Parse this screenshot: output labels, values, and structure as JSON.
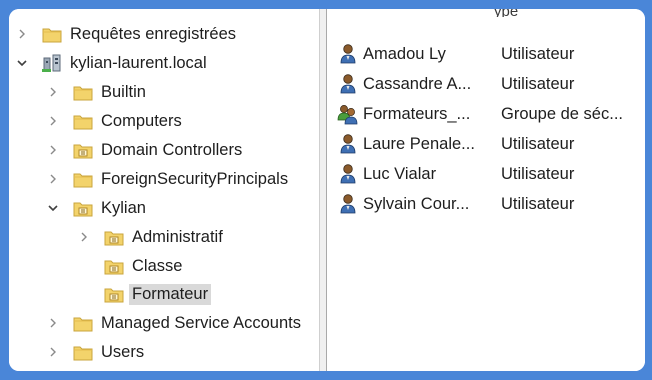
{
  "tree": {
    "items": [
      {
        "label": "Requêtes enregistrées",
        "icon": "folder-icon",
        "expander": "collapsed",
        "depth": 0
      },
      {
        "label": "kylian-laurent.local",
        "icon": "domain-icon",
        "expander": "expanded",
        "depth": 0
      },
      {
        "label": "Builtin",
        "icon": "folder-icon",
        "expander": "collapsed",
        "depth": 1
      },
      {
        "label": "Computers",
        "icon": "folder-icon",
        "expander": "collapsed",
        "depth": 1
      },
      {
        "label": "Domain Controllers",
        "icon": "ou-icon",
        "expander": "collapsed",
        "depth": 1
      },
      {
        "label": "ForeignSecurityPrincipals",
        "icon": "folder-icon",
        "expander": "collapsed",
        "depth": 1
      },
      {
        "label": "Kylian",
        "icon": "ou-icon",
        "expander": "expanded",
        "depth": 1
      },
      {
        "label": "Administratif",
        "icon": "ou-icon",
        "expander": "collapsed",
        "depth": 2
      },
      {
        "label": "Classe",
        "icon": "ou-icon",
        "expander": "none",
        "depth": 2
      },
      {
        "label": "Formateur",
        "icon": "ou-icon",
        "expander": "none",
        "depth": 2,
        "selected": true
      },
      {
        "label": "Managed Service Accounts",
        "icon": "folder-icon",
        "expander": "collapsed",
        "depth": 1
      },
      {
        "label": "Users",
        "icon": "folder-icon",
        "expander": "collapsed",
        "depth": 1
      }
    ]
  },
  "list": {
    "header_type_partial": "ype",
    "rows": [
      {
        "name": "Amadou Ly",
        "type": "Utilisateur",
        "icon": "user-icon"
      },
      {
        "name": "Cassandre A...",
        "type": "Utilisateur",
        "icon": "user-icon"
      },
      {
        "name": "Formateurs_...",
        "type": "Groupe de séc...",
        "icon": "group-icon"
      },
      {
        "name": "Laure Penale...",
        "type": "Utilisateur",
        "icon": "user-icon"
      },
      {
        "name": "Luc Vialar",
        "type": "Utilisateur",
        "icon": "user-icon"
      },
      {
        "name": "Sylvain Cour...",
        "type": "Utilisateur",
        "icon": "user-icon"
      }
    ]
  },
  "colors": {
    "background": "#4a86d8",
    "selection": "#d9d9d9",
    "folder": "#f3d36b",
    "user_body": "#3f6fb3"
  }
}
